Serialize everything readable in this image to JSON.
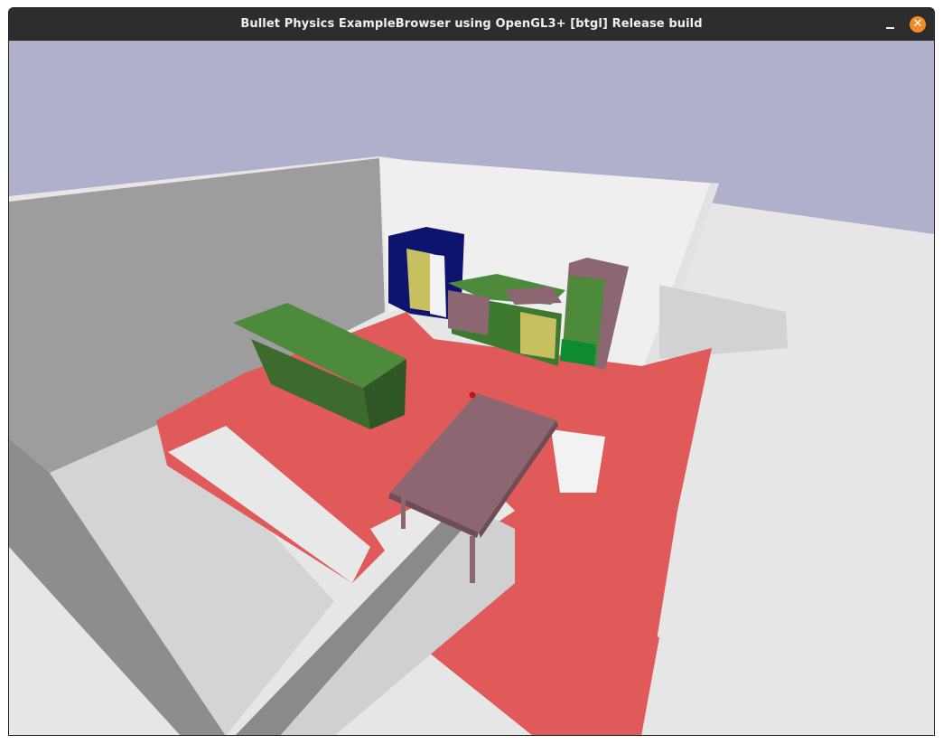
{
  "window": {
    "title": "Bullet Physics ExampleBrowser using OpenGL3+ [btgl] Release build",
    "controls": {
      "minimize": "minimize",
      "close": "close"
    }
  },
  "icons": {
    "minimize": "minimize-icon",
    "close": "close-icon"
  },
  "colors": {
    "titlebar": "#2d2d2d",
    "close_button": "#f08c2a",
    "sky": "#b0b0cc",
    "floor": "#e6e6e6",
    "room_walls": "#9a9a9a",
    "navigation_overlay": "#e05a5a",
    "green_furniture": "#4d8a3c",
    "mauve_furniture": "#8c6670",
    "fridge_blue": "#0c1470",
    "yellow_panels": "#c8c060"
  }
}
